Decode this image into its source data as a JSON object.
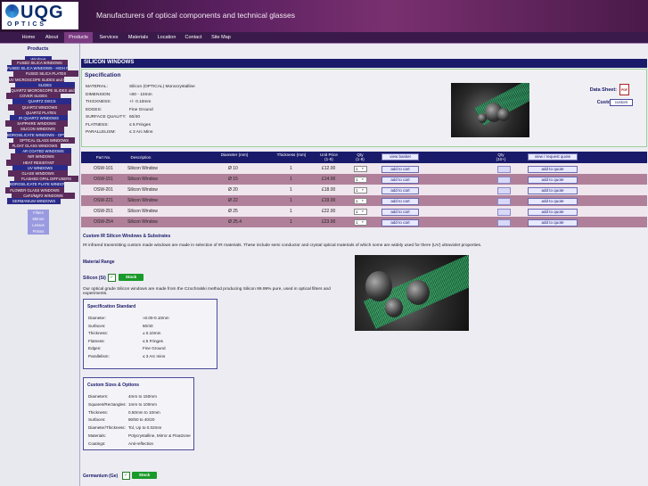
{
  "header": {
    "logo_text": "UQG",
    "logo_sub": "OPTICS",
    "tagline": "Manufacturers of optical components and technical glasses"
  },
  "nav": [
    {
      "label": "Home"
    },
    {
      "label": "About"
    },
    {
      "label": "Products"
    },
    {
      "label": "Services"
    },
    {
      "label": "Materials"
    },
    {
      "label": "Location"
    },
    {
      "label": "Contact"
    },
    {
      "label": "Site Map"
    }
  ],
  "sidebar": {
    "title": "Products",
    "items": [
      "Windows",
      "FUSED SILICA WINDOWS",
      "FUSED SILICA WINDOWS - HIGH POWER",
      "FUSED SILICA PLATES",
      "UV MICROSCOPE SLIDES and COVER",
      "SLIDES",
      "QUARTZ MICROSCOPE SLIDES and",
      "COVER SLIDES",
      "QUARTZ DISCS",
      "QUARTZ WINDOWS",
      "QUARTZ PLATES",
      "IR QUARTZ WINDOWS",
      "SAPPHIRE WINDOWS",
      "SILICON WINDOWS",
      "BOROSILICATE WINDOWS - OPTICAL",
      "OPTICAL GLASS WINDOWS",
      "FLOAT GLASS WINDOWS",
      "AR COATED WINDOWS",
      "NIR WINDOWS",
      "HEAT RESISTANT",
      "UV WINDOWS",
      "GLASS WINDOWS",
      "FLASHED OPAL DIFFUSERS",
      "BOROSILICATE PLATE WINDOWS",
      "FLOWER GLASS WINDOWS",
      "CaF2/MgF2 WINDOWS",
      "GERMANIUM WINDOWS",
      "Filters",
      "Mirrors",
      "Lenses",
      "Prisms"
    ]
  },
  "page_title": "SILICON WINDOWS",
  "spec": {
    "heading": "Specification",
    "rows": [
      {
        "label": "MATERIAL:",
        "value": "Silicon (OPTICAL) Monocrystalline"
      },
      {
        "label": "DIMENSION:",
        "value": "≈00 - 10mm"
      },
      {
        "label": "THICKNESS:",
        "value": "+/- 0.10mm"
      },
      {
        "label": "EDGES:",
        "value": "Fine Ground"
      },
      {
        "label": "SURFACE QUALITY:",
        "value": "60/40"
      },
      {
        "label": "FLATNESS:",
        "value": "≤ 5 Fringes"
      },
      {
        "label": "PARALLELISM:",
        "value": "≤ 3 Arc Mins"
      }
    ],
    "data_sheet_label": "Data Sheet:",
    "pdf_label": "PDF",
    "custom_label": "Custom:",
    "custom_button": "custom"
  },
  "table": {
    "headers": {
      "part": "Part No.",
      "desc": "Description",
      "dia": "Diameter (mm)",
      "thick": "Thickness (mm)",
      "price": "Unit Price (1-9)",
      "qty": "Qty (1-9)",
      "basket": "view basket",
      "qty10": "Qty (10+)",
      "quote": "view / request quote"
    },
    "rows": [
      {
        "part": "OSW-101",
        "desc": "Silicon Window",
        "dia": "Ø 10",
        "thick": "1",
        "price": "£12.00",
        "qty": "1",
        "cart": "add to cart",
        "quote": "add to quote"
      },
      {
        "part": "OSW-151",
        "desc": "Silicon Window",
        "dia": "Ø 15",
        "thick": "1",
        "price": "£14.00",
        "qty": "1",
        "cart": "add to cart",
        "quote": "add to quote"
      },
      {
        "part": "OSW-201",
        "desc": "Silicon Window",
        "dia": "Ø 20",
        "thick": "1",
        "price": "£18.00",
        "qty": "1",
        "cart": "add to cart",
        "quote": "add to quote"
      },
      {
        "part": "OSW-221",
        "desc": "Silicon Window",
        "dia": "Ø 22",
        "thick": "1",
        "price": "£19.00",
        "qty": "1",
        "cart": "add to cart",
        "quote": "add to quote"
      },
      {
        "part": "OSW-251",
        "desc": "Silicon Window",
        "dia": "Ø 25",
        "thick": "1",
        "price": "£22.00",
        "qty": "1",
        "cart": "add to cart",
        "quote": "add to quote"
      },
      {
        "part": "OSW-254",
        "desc": "Silicon Window",
        "dia": "Ø 25.4",
        "thick": "1",
        "price": "£23.00",
        "qty": "1",
        "cart": "add to cart",
        "quote": "add to quote"
      }
    ]
  },
  "custom": {
    "title": "Custom IR Silicon Windows & Substrates",
    "intro": "IR infrared transmitting custom made windows are made in selection of IR materials. These include semi conductor and crystal optical materials of which some are widely used for there (UV) ultraviolet properties.",
    "material_range": "Material Range",
    "silicon_label": "Silicon (Si)",
    "stock_label": "Stock",
    "silicon_para": "Our optical grade Silicon windows are made from the Czochralski method producing Silicon 99.99% pure, used in optical filters and experiments.",
    "std_title": "Specification Standard",
    "std_rows": [
      {
        "label": "Diameter:",
        "value": "≈0.00-0.10mm"
      },
      {
        "label": "Surfaces:",
        "value": "60/40"
      },
      {
        "label": "Thickness:",
        "value": "± 0.10mm"
      },
      {
        "label": "Flatness:",
        "value": "≤ 5 Fringes"
      },
      {
        "label": "Edges:",
        "value": "Fine Ground"
      },
      {
        "label": "Parallelism:",
        "value": "≤ 3 Arc mins"
      }
    ],
    "opt_title": "Custom Sizes & Options",
    "opt_rows": [
      {
        "label": "Diameters:",
        "value": "4mm to 150mm"
      },
      {
        "label": "Squares/Rectangles:",
        "value": "1mm to 100mm"
      },
      {
        "label": "Thickness:",
        "value": "0.50mm to 10mm"
      },
      {
        "label": "Surfaces:",
        "value": "80/50 to 40/20"
      },
      {
        "label": "Diameter/Thickness:",
        "value": "Tol, Up to 0.02mm"
      },
      {
        "label": "Materials:",
        "value": "Polycrystalline, Mirror & Floatzone"
      },
      {
        "label": "Coatings:",
        "value": "Anti-reflection"
      }
    ],
    "germanium_label": "Germanium (Ge)",
    "stock_label2": "Stock"
  }
}
